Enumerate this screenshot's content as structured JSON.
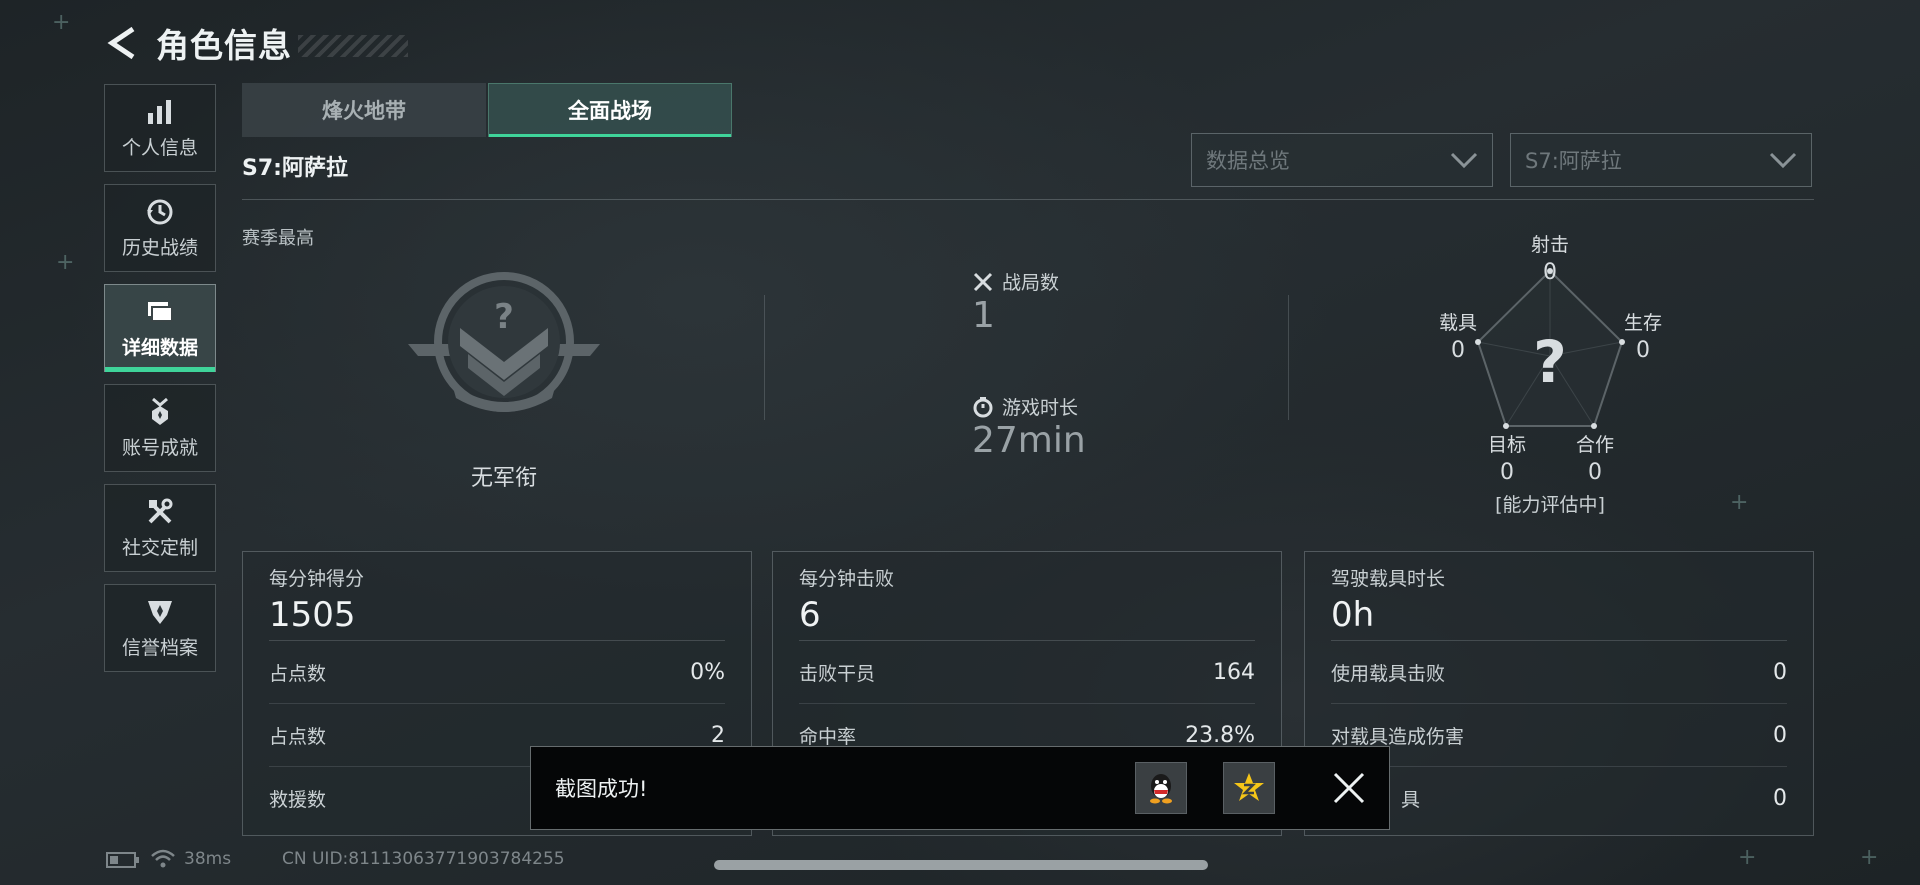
{
  "header": {
    "title": "角色信息",
    "back_icon": "back-arrow-icon"
  },
  "sidebar": {
    "items": [
      {
        "label": "个人信息",
        "icon": "bar-chart-icon",
        "active": false
      },
      {
        "label": "历史战绩",
        "icon": "history-clock-icon",
        "active": false
      },
      {
        "label": "详细数据",
        "icon": "folders-icon",
        "active": true
      },
      {
        "label": "账号成就",
        "icon": "medal-icon",
        "active": false
      },
      {
        "label": "社交定制",
        "icon": "tools-icon",
        "active": false
      },
      {
        "label": "信誉档案",
        "icon": "shield-emblem-icon",
        "active": false
      }
    ]
  },
  "mode_tabs": [
    {
      "label": "烽火地带",
      "active": false
    },
    {
      "label": "全面战场",
      "active": true
    }
  ],
  "season": {
    "label": "S7:阿萨拉"
  },
  "dropdowns": {
    "data_type": {
      "value": "数据总览"
    },
    "season": {
      "value": "S7:阿萨拉"
    }
  },
  "season_best": {
    "label": "赛季最高",
    "rank_name": "无军衔"
  },
  "matches": {
    "label": "战局数",
    "value": "1"
  },
  "playtime": {
    "label": "游戏时长",
    "value": "27min"
  },
  "radar": {
    "center_mark": "?",
    "status": "[能力评估中]",
    "axes": [
      {
        "label": "射击",
        "value": "0"
      },
      {
        "label": "生存",
        "value": "0"
      },
      {
        "label": "合作",
        "value": "0"
      },
      {
        "label": "目标",
        "value": "0"
      },
      {
        "label": "载具",
        "value": "0"
      }
    ]
  },
  "panels": [
    {
      "title": "每分钟得分",
      "value": "1505",
      "rows": [
        {
          "label": "占点数",
          "value": "0%"
        },
        {
          "label": "占点数",
          "value": "2"
        },
        {
          "label": "救援数",
          "value": ""
        }
      ]
    },
    {
      "title": "每分钟击败",
      "value": "6",
      "rows": [
        {
          "label": "击败干员",
          "value": "164"
        },
        {
          "label": "命中率",
          "value": "23.8%"
        },
        {
          "label": "",
          "value": ""
        }
      ]
    },
    {
      "title": "驾驶载具时长",
      "value": "0h",
      "rows": [
        {
          "label": "使用载具击败",
          "value": "0"
        },
        {
          "label": "对载具造成伤害",
          "value": "0"
        },
        {
          "label": "具",
          "value": "0"
        }
      ]
    }
  ],
  "toast": {
    "text": "截图成功!",
    "share_qq_icon": "qq-icon",
    "share_qzone_icon": "qzone-star-icon",
    "close_icon": "close-icon"
  },
  "status_bar": {
    "ping": "38ms",
    "uid": "CN UID:81113063771903784255"
  },
  "colors": {
    "accent": "#3fd49a",
    "background": "#22292d"
  }
}
